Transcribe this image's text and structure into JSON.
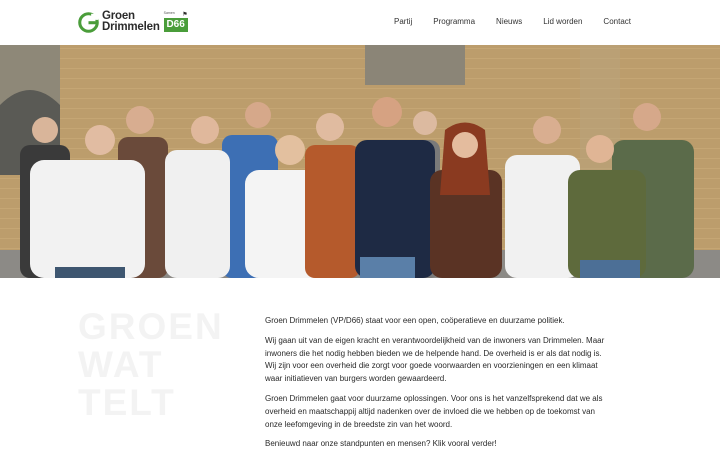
{
  "header": {
    "logo": {
      "line1": "Groen",
      "line2": "Drimmelen",
      "samen": "Samen",
      "d66": "D66"
    },
    "nav": [
      {
        "label": "Partij"
      },
      {
        "label": "Programma"
      },
      {
        "label": "Nieuws"
      },
      {
        "label": "Lid worden"
      },
      {
        "label": "Contact"
      }
    ]
  },
  "hero": {
    "alt": "Groepsfoto van de kandidaten van Groen Drimmelen"
  },
  "watermark": [
    "GROEN",
    "WAT",
    "TELT"
  ],
  "content": {
    "paragraphs": [
      "Groen Drimmelen (VP/D66) staat voor een open, coöperatieve en duurzame politiek.",
      "Wij gaan uit van de eigen kracht en verantwoordelijkheid van de inwoners van Drimmelen. Maar inwoners die het nodig hebben bieden we de helpende hand. De overheid is er als dat nodig is. Wij zijn voor een overheid die zorgt voor goede voorwaarden en voorzieningen en een klimaat waar initiatieven van burgers worden gewaardeerd.",
      "Groen Drimmelen gaat voor duurzame oplossingen. Voor ons is het vanzelfsprekend dat we als overheid en maatschappij altijd nadenken over de invloed die we hebben op de toekomst van onze leefomgeving in de breedste zin van het woord.",
      "Benieuwd naar onze standpunten en mensen? Klik vooral verder!"
    ]
  },
  "colors": {
    "brand_green": "#4a9d3a",
    "text": "#2a2a2a",
    "brick": "#c2a271"
  }
}
